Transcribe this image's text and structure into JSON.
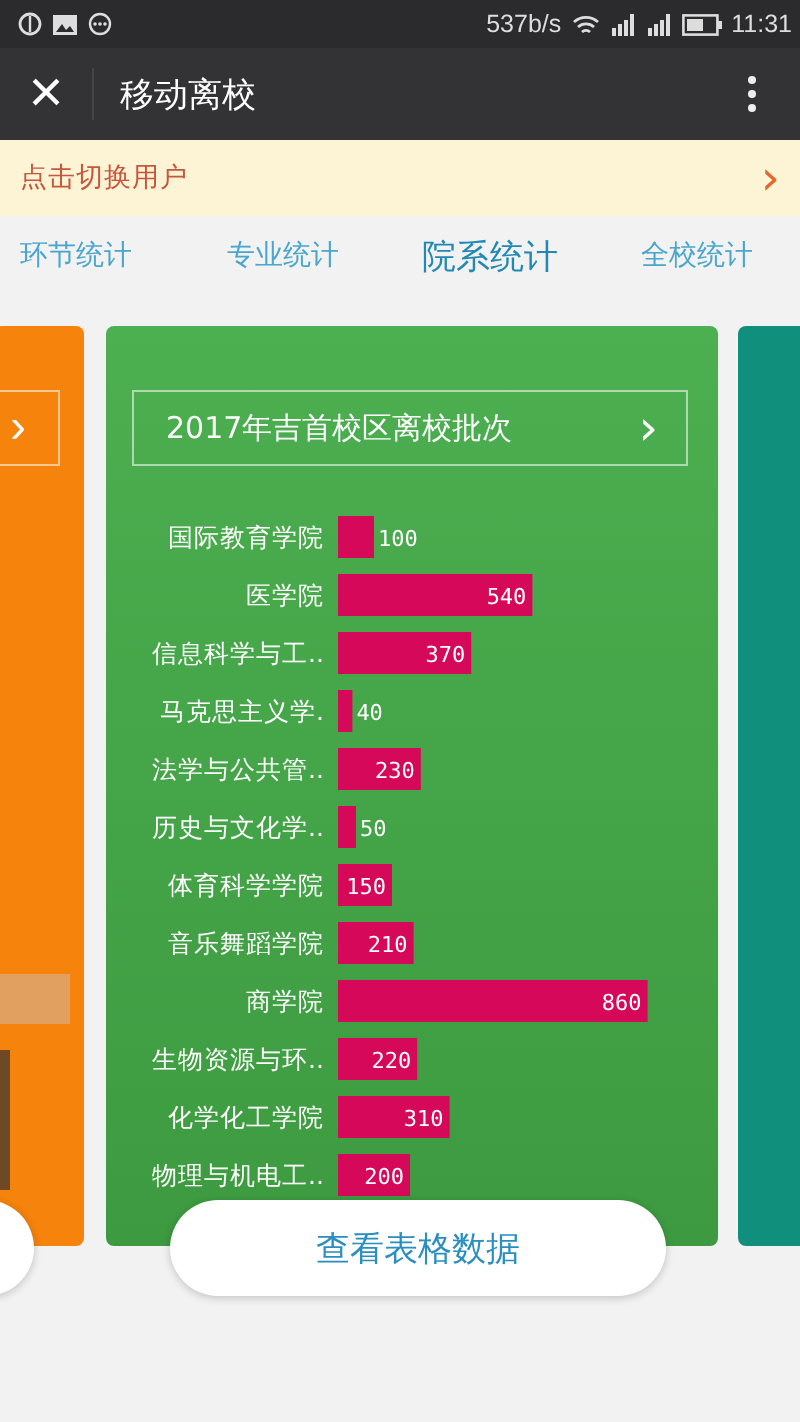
{
  "status_bar": {
    "speed": "537b/s",
    "time": "11:31"
  },
  "app_bar": {
    "close": "×",
    "title": "移动离校"
  },
  "banner": {
    "text": "点击切换用户",
    "arrow": "›"
  },
  "tabs": [
    {
      "label": "环节统计",
      "selected": false
    },
    {
      "label": "专业统计",
      "selected": false
    },
    {
      "label": "院系统计",
      "selected": true
    },
    {
      "label": "全校统计",
      "selected": false
    }
  ],
  "card": {
    "title": "2017年吉首校区离校批次",
    "arrow": "›",
    "prev_arrow": "›",
    "chart_data": {
      "type": "bar",
      "orientation": "horizontal",
      "data_labels": true,
      "categories": [
        "国际教育学院",
        "医学院",
        "信息科学与工..",
        "马克思主义学.",
        "法学与公共管..",
        "历史与文化学..",
        "体育科学学院",
        "音乐舞蹈学院",
        "商学院",
        "生物资源与环..",
        "化学化工学院",
        "物理与机电工.."
      ],
      "values": [
        100,
        540,
        370,
        40,
        230,
        50,
        150,
        210,
        860,
        220,
        310,
        200
      ]
    }
  },
  "table_button": "查看表格数据"
}
